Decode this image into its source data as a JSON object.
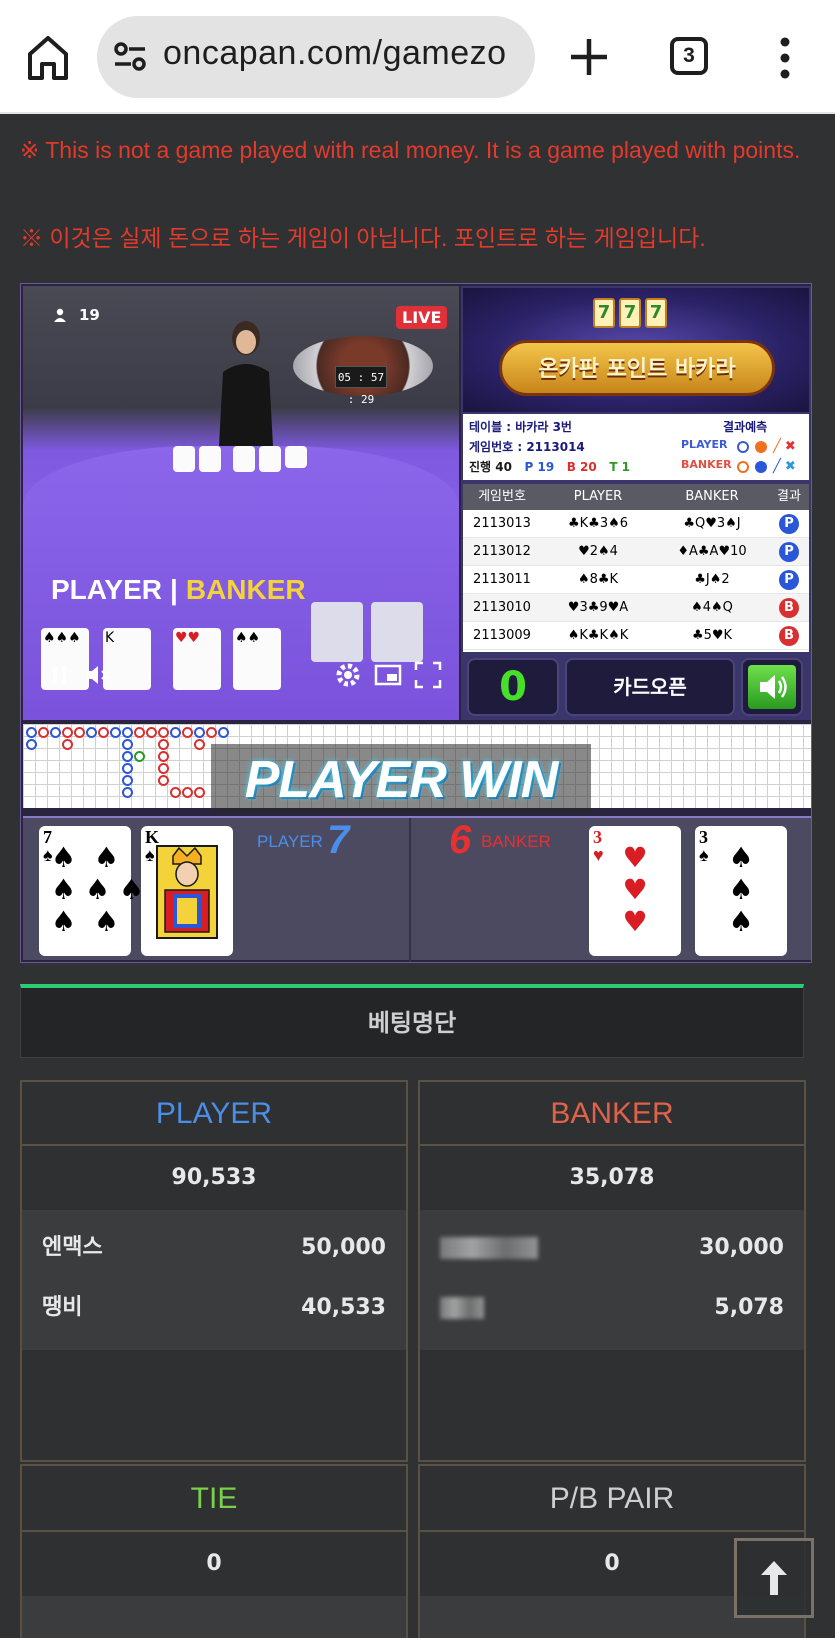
{
  "browser": {
    "url": "oncapan.com/gamezo",
    "tab_count": "3"
  },
  "notices": {
    "en": "※ This is not a game played with real money. It is a game played with points.",
    "ko": "※ 이것은 실제 돈으로 하는 게임이 아닙니다. 포인트로 하는 게임입니다."
  },
  "video": {
    "viewers": "19",
    "live": "LIVE",
    "timer": "05 : 57 : 29",
    "player_label": "PLAYER",
    "banker_label": "BANKER"
  },
  "banner": {
    "title": "온카판 포인트 바카라",
    "slots": [
      "7",
      "7",
      "7"
    ]
  },
  "table_info": {
    "table": "테이블 : 바카라 3번",
    "game_no": "게임번호 : 2113014",
    "progress": "진행 40",
    "p_count": "P 19",
    "b_count": "B 20",
    "t_count": "T 1",
    "prediction": "결과예측",
    "player": "PLAYER",
    "banker": "BANKER"
  },
  "history": {
    "headers": [
      "게임번호",
      "PLAYER",
      "BANKER",
      "결과"
    ],
    "rows": [
      {
        "no": "2113013",
        "player": "♣K♣3♠6",
        "banker": "♣Q♥3♠J",
        "result": "P"
      },
      {
        "no": "2113012",
        "player": "♥2♠4",
        "banker": "♦A♣A♥10",
        "result": "P"
      },
      {
        "no": "2113011",
        "player": "♠8♣K",
        "banker": "♣J♠2",
        "result": "P"
      },
      {
        "no": "2113010",
        "player": "♥3♣9♥A",
        "banker": "♠4♠Q",
        "result": "B"
      },
      {
        "no": "2113009",
        "player": "♠K♣K♠K",
        "banker": "♣5♥K",
        "result": "B"
      }
    ]
  },
  "controls": {
    "count": "0",
    "open_cards": "카드오픈"
  },
  "result": {
    "win_text": "PLAYER WIN",
    "player_label": "PLAYER",
    "player_score": "7",
    "banker_label": "BANKER",
    "banker_score": "6",
    "player_cards": [
      {
        "rank": "7",
        "suit": "♠"
      },
      {
        "rank": "K",
        "suit": "♠"
      }
    ],
    "banker_cards": [
      {
        "rank": "3",
        "suit": "♥"
      },
      {
        "rank": "3",
        "suit": "♠"
      }
    ]
  },
  "betting": {
    "title": "베팅명단",
    "player": {
      "label": "PLAYER",
      "total": "90,533",
      "entries": [
        {
          "name": "엔맥스",
          "amount": "50,000"
        },
        {
          "name": "땡비",
          "amount": "40,533"
        }
      ]
    },
    "banker": {
      "label": "BANKER",
      "total": "35,078",
      "entries": [
        {
          "name": "",
          "amount": "30,000"
        },
        {
          "name": "",
          "amount": "5,078"
        }
      ]
    },
    "tie": {
      "label": "TIE",
      "total": "0"
    },
    "pair": {
      "label": "P/B PAIR",
      "total": "0"
    }
  },
  "colors": {
    "notice": "#e33a2c",
    "player": "#4a8ee8",
    "banker": "#e0624a",
    "tie": "#7ad04a",
    "accent_green": "#2ecc71"
  },
  "icons": [
    "home-icon",
    "site-settings-icon",
    "new-tab-icon",
    "tab-switcher-icon",
    "more-menu-icon",
    "person-icon",
    "pause-icon",
    "mute-icon",
    "settings-icon",
    "pip-icon",
    "fullscreen-icon",
    "speaker-icon",
    "arrow-up-icon"
  ]
}
